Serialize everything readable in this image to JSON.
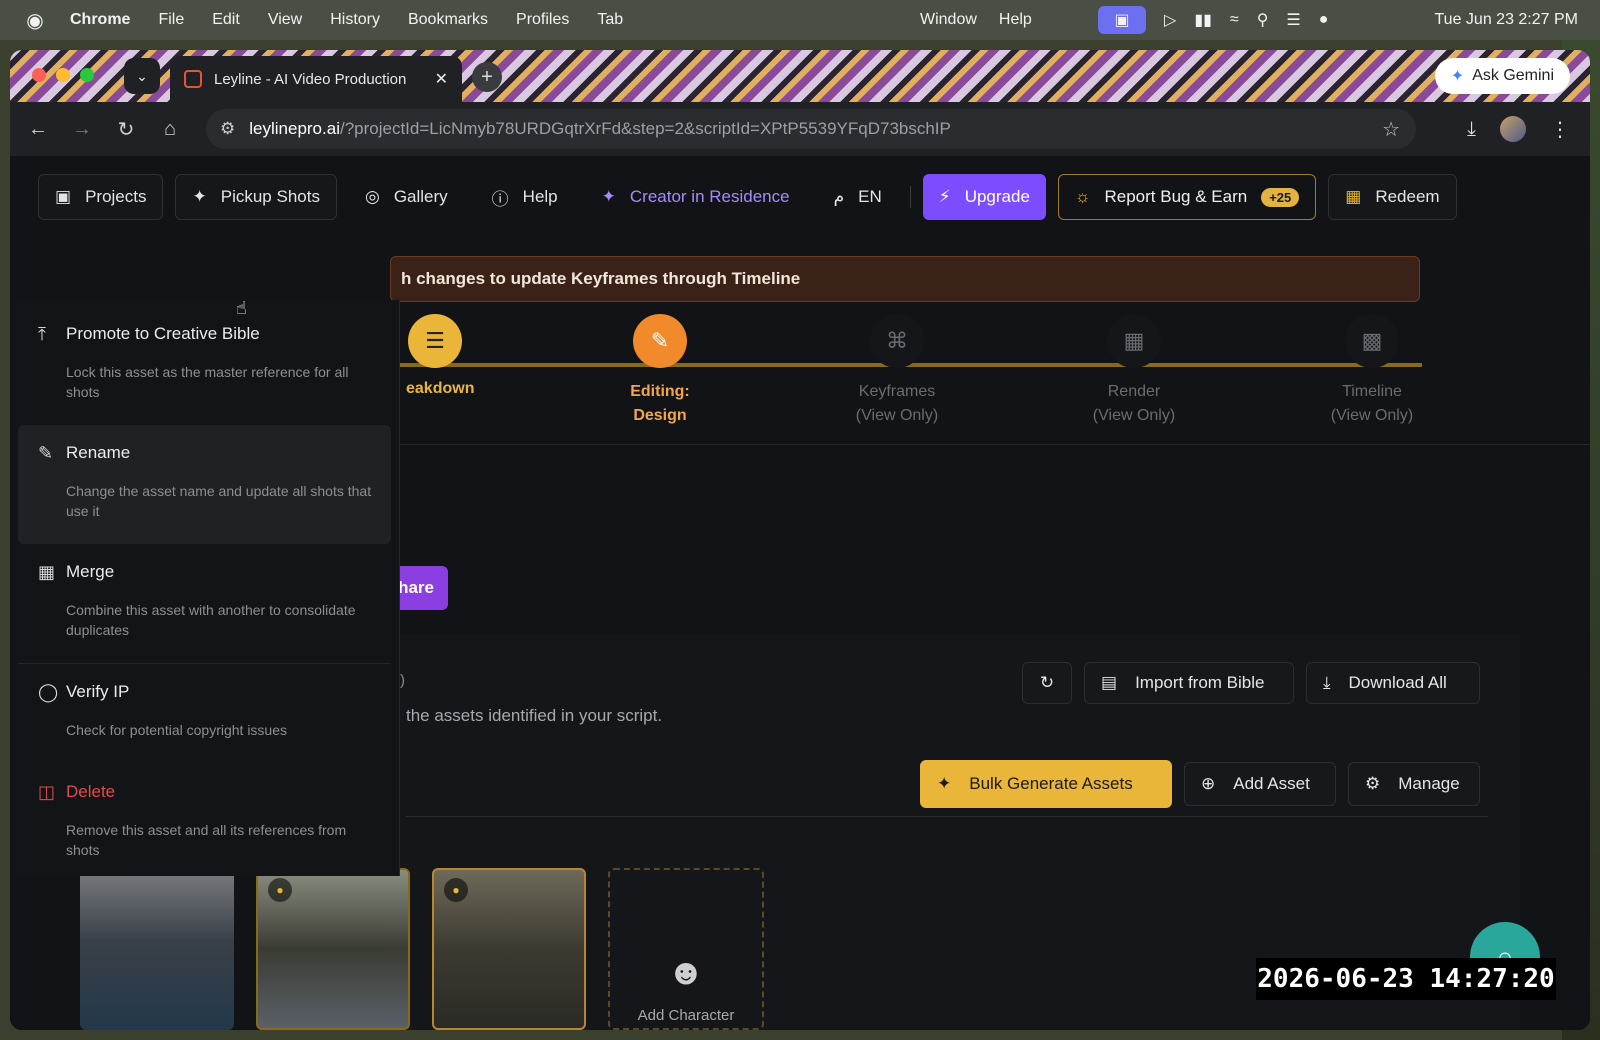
{
  "menubar": {
    "apple": "",
    "app": "Chrome",
    "items": [
      "File",
      "Edit",
      "View",
      "History",
      "Bookmarks",
      "Profiles",
      "Tab"
    ],
    "right_items": [
      "Window",
      "Help"
    ],
    "clock": "Tue Jun 23  2:27 PM"
  },
  "browser": {
    "tab_title": "Leyline - AI Video Production",
    "ask_gemini": "Ask Gemini",
    "url_host": "leylinepro.ai",
    "url_path": "/?projectId=LicNmyb78URDGqtrXrFd&step=2&scriptId=XPtP5539YFqD73bschIP"
  },
  "appnav": {
    "projects": "Projects",
    "pickup_shots": "Pickup Shots",
    "gallery": "Gallery",
    "help": "Help",
    "creator": "Creator in Residence",
    "lang": "EN",
    "upgrade": "Upgrade",
    "report_bug": "Report Bug & Earn",
    "report_badge": "+25",
    "redeem": "Redeem"
  },
  "banner": "h changes to update Keyframes through Timeline",
  "steps": [
    {
      "label": "eakdown",
      "state": "done"
    },
    {
      "label1": "Editing:",
      "label2": "Design",
      "state": "active"
    },
    {
      "label1": "Keyframes",
      "label2": "(View Only)",
      "state": "future"
    },
    {
      "label1": "Render",
      "label2": "(View Only)",
      "state": "future"
    },
    {
      "label1": "Timeline",
      "label2": "(View Only)",
      "state": "future"
    }
  ],
  "share_label": "hare",
  "paren": ")",
  "description": "the assets identified in your script.",
  "actions": {
    "import": "Import from Bible",
    "download": "Download All",
    "bulk": "Bulk Generate Assets",
    "add": "Add Asset",
    "manage": "Manage"
  },
  "add_character": "Add Character",
  "context_menu": [
    {
      "title": "Promote to Creative Bible",
      "desc": "Lock this asset as the master reference for all shots",
      "icon": "arrow-up-to-line-icon"
    },
    {
      "title": "Rename",
      "desc": "Change the asset name and update all shots that use it",
      "icon": "pencil-icon"
    },
    {
      "title": "Merge",
      "desc": "Combine this asset with another to consolidate duplicates",
      "icon": "merge-icon"
    },
    {
      "title": "Verify IP",
      "desc": "Check for potential copyright issues",
      "icon": "shield-icon"
    },
    {
      "title": "Delete",
      "desc": "Remove this asset and all its references from shots",
      "icon": "trash-icon"
    }
  ],
  "timestamp": "2026-06-23  14:27:20",
  "colors": {
    "accent_gold": "#e9b63a",
    "upgrade_purple": "#7c4dff",
    "active_orange": "#f08a2a",
    "danger": "#e34b4b"
  }
}
